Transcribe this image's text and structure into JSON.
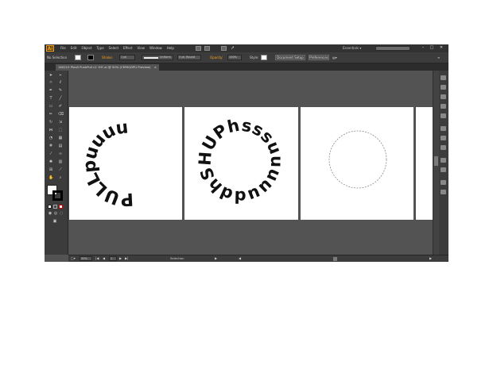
{
  "app": {
    "logo": "Ai",
    "workspace": "Essentials ▾"
  },
  "menu": [
    "File",
    "Edit",
    "Object",
    "Type",
    "Select",
    "Effect",
    "View",
    "Window",
    "Help"
  ],
  "control_bar": {
    "selection_label": "No Selection",
    "stroke_label": "Stroke:",
    "stroke_weight": "1 pt",
    "brush_label": "Uniform",
    "dash_label": "5 pt. Round",
    "opacity_label": "Opacity:",
    "opacity_value": "100%",
    "style_label": "Style:",
    "document_setup": "Document Setup",
    "preferences": "Preferences"
  },
  "document_tab": {
    "title": "160215 Plex9 PushPull c2 ‘09’.ai @ 50% (CMYK/GPU Preview)",
    "close": "×"
  },
  "artwork": {
    "pull_text": "PULLpuuuuullllllll",
    "push_text": "sssuuuuuddhSHUPhhh"
  },
  "status_bar": {
    "zoom": "50%",
    "artboard_number": "1",
    "tool_label": "Selection"
  },
  "colors": {
    "app_bg": "#535353",
    "panel_bg": "#3c3c3c",
    "menubar_bg": "#323232",
    "accent": "#f7a21b"
  },
  "icons": [
    "selection-tool-icon",
    "direct-selection-tool-icon",
    "pen-tool-icon",
    "type-tool-icon",
    "line-tool-icon",
    "rectangle-tool-icon",
    "paintbrush-tool-icon",
    "pencil-tool-icon",
    "rotate-tool-icon",
    "scale-tool-icon",
    "width-tool-icon",
    "free-transform-tool-icon",
    "shape-builder-tool-icon",
    "perspective-grid-tool-icon",
    "mesh-tool-icon",
    "gradient-tool-icon",
    "eyedropper-tool-icon",
    "blend-tool-icon",
    "symbol-sprayer-tool-icon",
    "column-graph-tool-icon",
    "artboard-tool-icon",
    "slice-tool-icon",
    "hand-tool-icon",
    "zoom-tool-icon"
  ]
}
